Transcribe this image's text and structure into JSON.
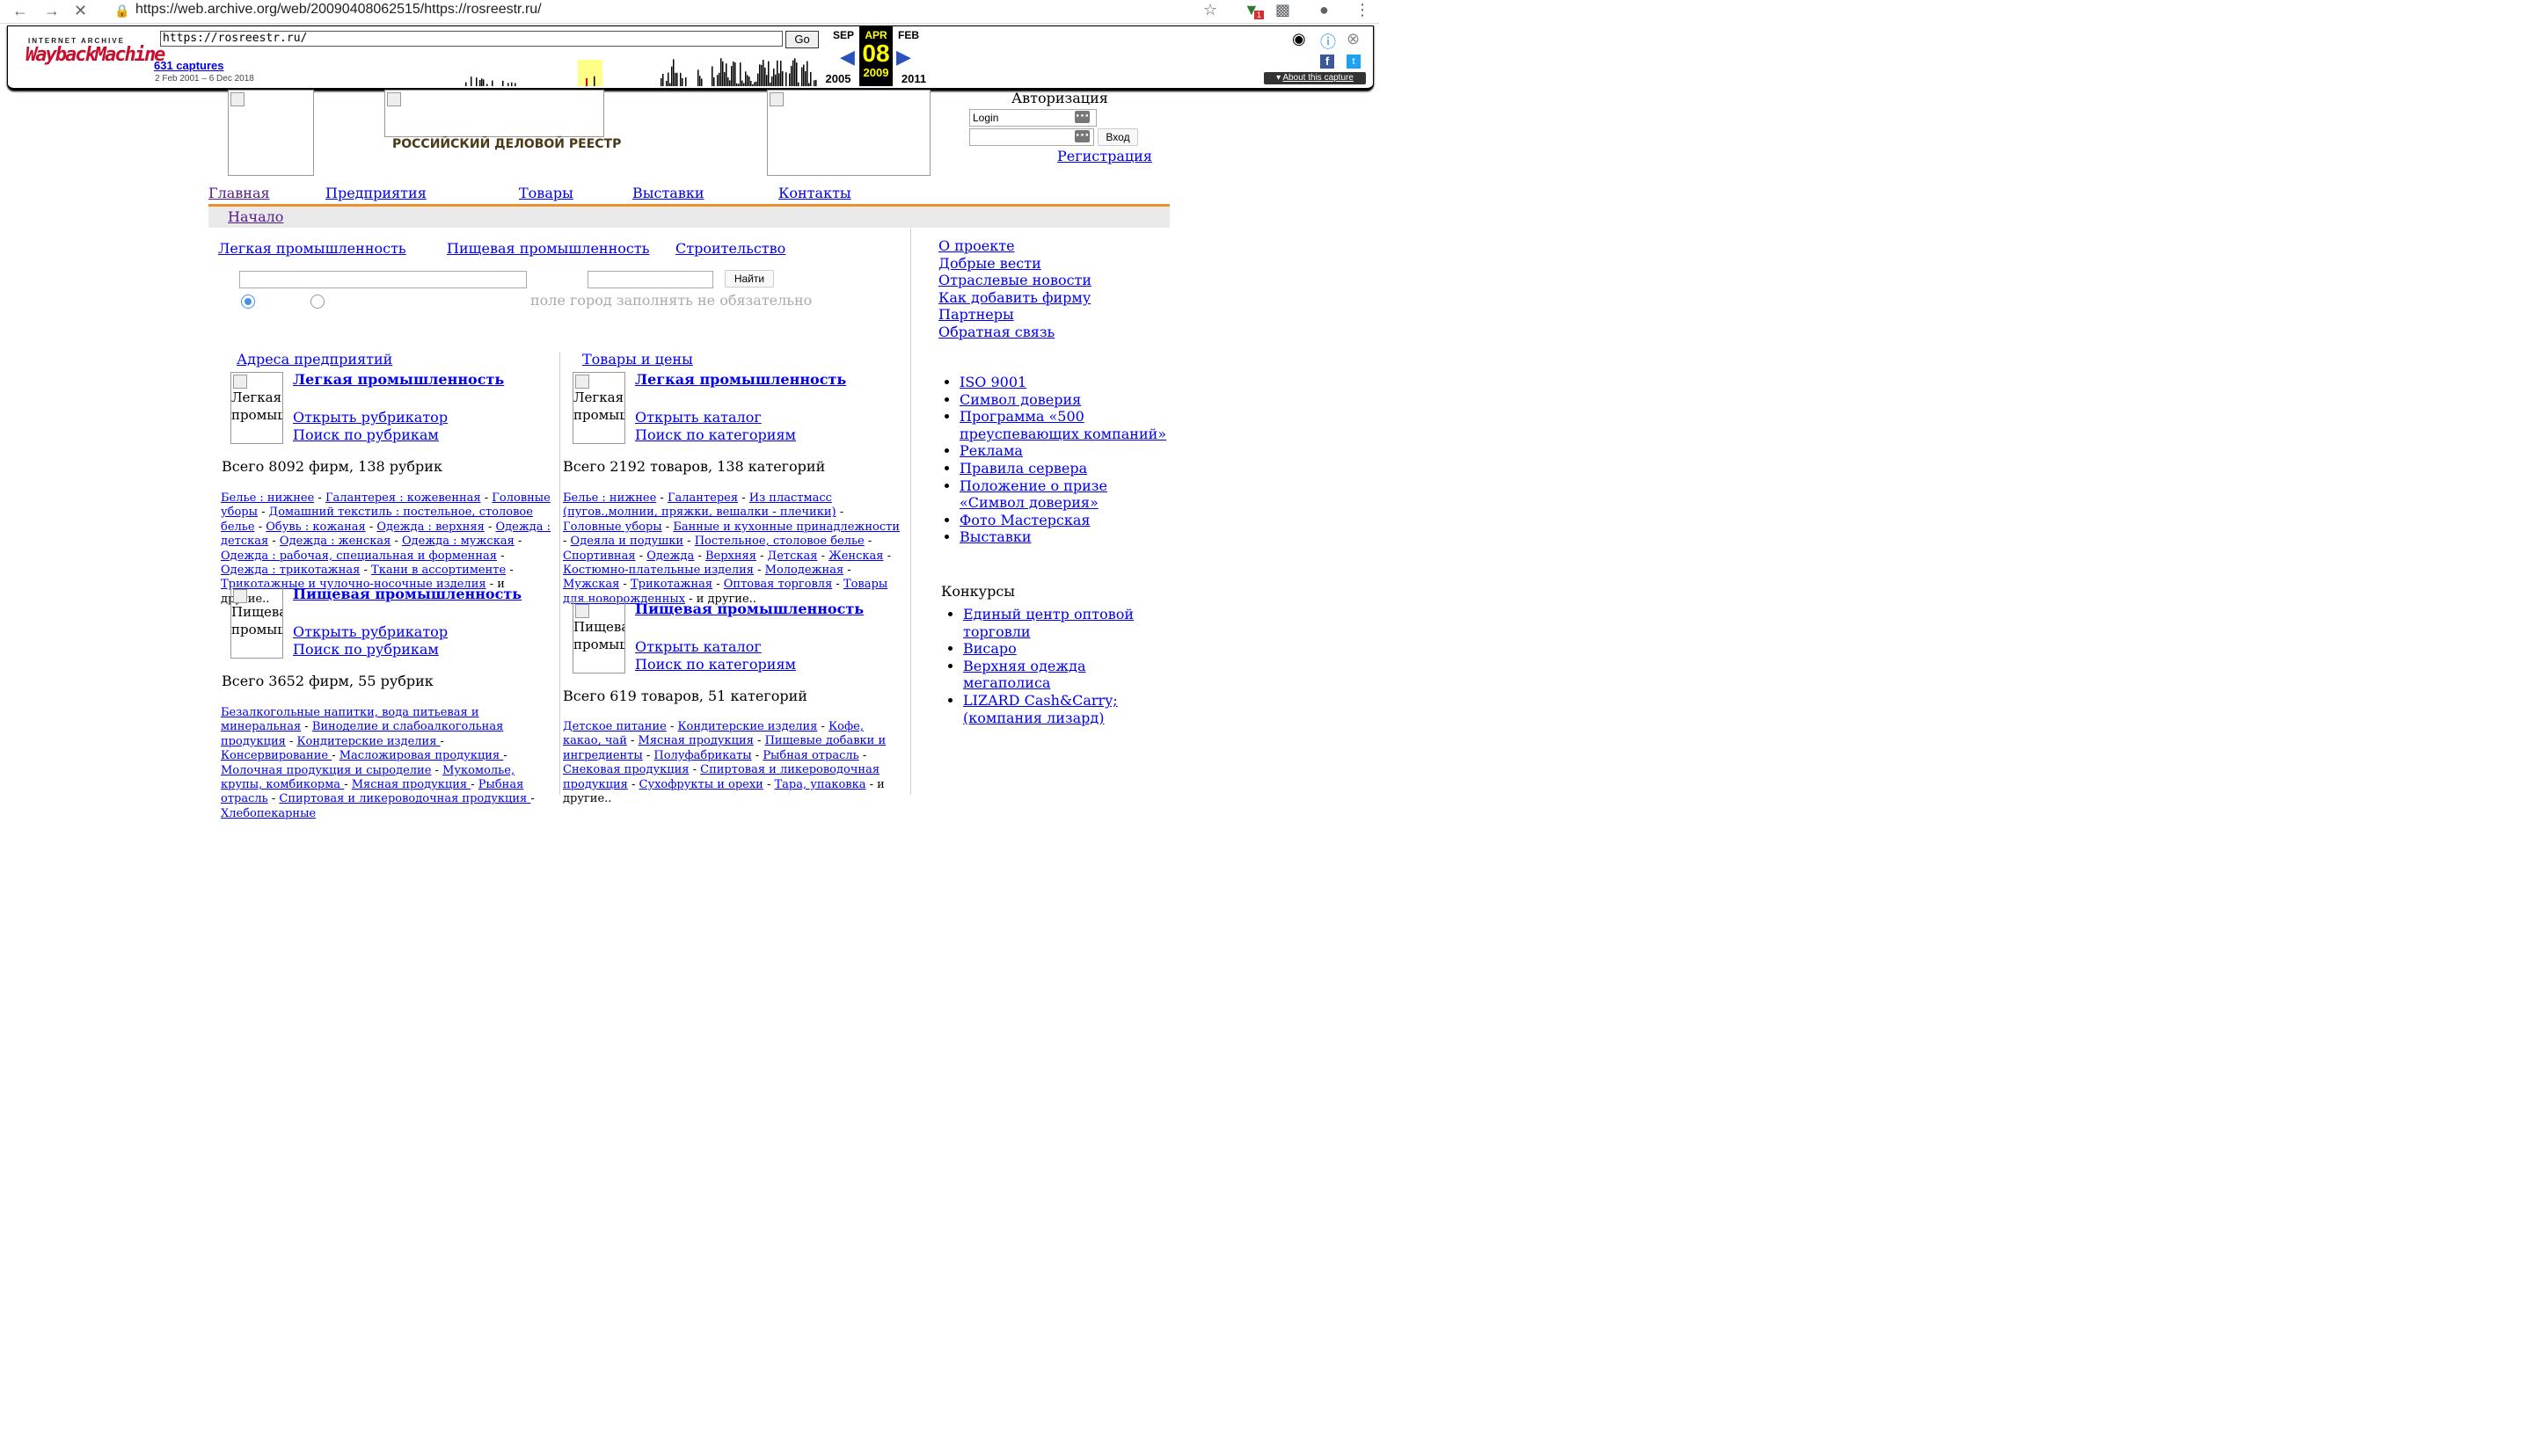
{
  "browser": {
    "url": "https://web.archive.org/web/20090408062515/https://rosreestr.ru/",
    "badge": "1"
  },
  "wayback": {
    "logo_top": "INTERNET ARCHIVE",
    "logo_main": "WaybackMachine",
    "url_value": "https://rosreestr.ru/",
    "go": "Go",
    "captures": "631 captures",
    "date_range": "2 Feb 2001 – 6 Dec 2018",
    "prev_month": "SEP",
    "cur_month": "APR",
    "next_month": "FEB",
    "day": "08",
    "prev_year": "2005",
    "cur_year": "2009",
    "next_year": "2011",
    "about": "About this capture"
  },
  "site": {
    "title": "РОССИЙСКИЙ ДЕЛОВОЙ РЕЕСТР",
    "auth_title": "Авторизация",
    "login_value": "Login",
    "login_button": "Вход",
    "register": "Регистрация",
    "menu": [
      "Главная",
      "Предприятия",
      "Товары",
      "Выставки",
      "Контакты"
    ],
    "breadcrumb": "Начало",
    "sector_links": [
      "Легкая промышленность",
      "Пищевая промышленность",
      "Строительство"
    ],
    "search_button": "Найти",
    "city_hint": "поле город заполнять не обязательно"
  },
  "left_col": {
    "header": "Адреса предприятий",
    "blocks": [
      {
        "thumb_alt": "Легкая промышленность",
        "title": "Легкая промышленность",
        "open": "Открыть рубрикатор",
        "search": "Поиск по рубрикам",
        "total": "Всего 8092 фирм, 138 рубрик",
        "cats": [
          "Белье : нижнее",
          "Галантерея : кожевенная",
          "Головные уборы",
          "Домашний текстиль : постельное, столовое белье",
          "Обувь : кожаная",
          "Одежда : верхняя",
          "Одежда : детская",
          "Одежда : женская",
          "Одежда : мужская",
          "Одежда : рабочая, специальная и форменная",
          "Одежда : трикотажная",
          "Ткани в ассортименте",
          "Трикотажные и чулочно-носочные изделия"
        ]
      },
      {
        "thumb_alt": "Пищевая промышленность",
        "title": "Пищевая промышленность",
        "open": "Открыть рубрикатор",
        "search": "Поиск по рубрикам",
        "total": "Всего 3652 фирм, 55 рубрик",
        "cats": [
          "Безалкогольные напитки, вода питьевая и минеральная",
          "Виноделие и слабоалкогольная продукция",
          "Кондитерские изделия ",
          "Консервирование ",
          "Масложировая продукция ",
          "Молочная продукция и сыроделие",
          "Мукомолье, крупы, комбикорма ",
          "Мясная продукция ",
          "Рыбная отрасль",
          "Спиртовая и ликероводочная продукция ",
          "Хлебопекарные"
        ]
      }
    ]
  },
  "mid_col": {
    "header": "Товары и цены",
    "blocks": [
      {
        "thumb_alt": "Легкая промышленность",
        "title": "Легкая промышленность",
        "open": "Открыть каталог",
        "search": "Поиск по категориям",
        "total": "Всего 2192 товаров, 138 категорий",
        "cats": [
          "Белье : нижнее",
          "Галантерея",
          "Из пластмасс (пугов.,молнии, пряжки, вешалки - плечики)",
          "Головные уборы",
          "Банные и кухонные принадлежности",
          "Одеяла и подушки",
          "Постельное, столовое белье",
          "Спортивная",
          "Одежда",
          "Верхняя",
          "Детская",
          "Женская",
          "Костюмно-плательные изделия",
          "Молодежная",
          "Мужская",
          "Трикотажная",
          "Оптовая торговля",
          "Товары для новорожденных"
        ]
      },
      {
        "thumb_alt": "Пищевая промышленность",
        "title": "Пищевая промышленность",
        "open": "Открыть каталог",
        "search": "Поиск по категориям",
        "total": "Всего 619 товаров, 51 категорий",
        "cats": [
          "Детское питание",
          "Кондитерские изделия",
          "Кофе, какао, чай",
          "Мясная продукция",
          "Пищевые добавки и ингредиенты",
          "Полуфабрикаты",
          "Рыбная отрасль",
          "Снековая продукция",
          "Спиртовая и ликероводочная продукция",
          "Сухофрукты и орехи",
          "Тара, упаковка"
        ]
      }
    ],
    "others": " - и другие.."
  },
  "right_col": {
    "links": [
      "О проекте",
      "Добрые вести",
      "Отраслевые новости",
      "Как добавить фирму",
      "Партнеры",
      "Обратная связь"
    ],
    "list1": [
      "ISO 9001",
      "Символ доверия",
      "Программа «500 преуспевающих компаний»",
      "Реклама",
      "Правила сервера",
      "Положение о призе «Символ доверия»",
      "Фото Мастерская",
      "Выставки"
    ],
    "contests_title": "Конкурсы",
    "list2": [
      "Единый центр оптовой торговли",
      "Висаро",
      "Верхняя одежда мегаполиса",
      "LIZARD Cash&Carry; (компания лизард)"
    ]
  }
}
